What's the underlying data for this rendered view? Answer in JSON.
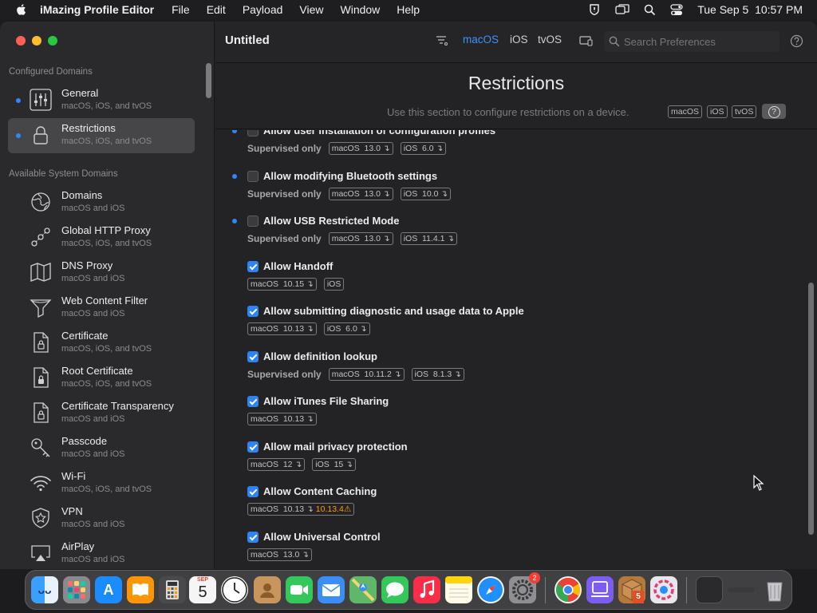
{
  "menubar": {
    "app_name": "iMazing Profile Editor",
    "menus": [
      "File",
      "Edit",
      "Payload",
      "View",
      "Window",
      "Help"
    ],
    "datetime": "Tue Sep 5  10:57 PM"
  },
  "toolbar": {
    "title": "Untitled",
    "platforms": [
      "macOS",
      "iOS",
      "tvOS"
    ],
    "active_platform": "macOS",
    "search_placeholder": "Search Preferences"
  },
  "sidebar": {
    "configured_title": "Configured Domains",
    "configured": [
      {
        "name": "General",
        "sub": "macOS, iOS, and tvOS",
        "icon": "sliders-icon"
      },
      {
        "name": "Restrictions",
        "sub": "macOS, iOS, and tvOS",
        "icon": "lock-icon"
      }
    ],
    "available_title": "Available System Domains",
    "available": [
      {
        "name": "Domains",
        "sub": "macOS and iOS",
        "icon": "globe-icon"
      },
      {
        "name": "Global HTTP Proxy",
        "sub": "macOS, iOS, and tvOS",
        "icon": "proxy-icon"
      },
      {
        "name": "DNS Proxy",
        "sub": "macOS and iOS",
        "icon": "map-icon"
      },
      {
        "name": "Web Content Filter",
        "sub": "macOS and iOS",
        "icon": "funnel-icon"
      },
      {
        "name": "Certificate",
        "sub": "macOS, iOS, and tvOS",
        "icon": "certificate-icon"
      },
      {
        "name": "Root Certificate",
        "sub": "macOS, iOS, and tvOS",
        "icon": "root-certificate-icon"
      },
      {
        "name": "Certificate Transparency",
        "sub": "macOS and iOS",
        "icon": "certificate-transparency-icon"
      },
      {
        "name": "Passcode",
        "sub": "macOS and iOS",
        "icon": "key-icon"
      },
      {
        "name": "Wi-Fi",
        "sub": "macOS, iOS, and tvOS",
        "icon": "wifi-icon"
      },
      {
        "name": "VPN",
        "sub": "macOS and iOS",
        "icon": "vpn-shield-icon"
      },
      {
        "name": "AirPlay",
        "sub": "macOS and iOS",
        "icon": "airplay-icon"
      }
    ]
  },
  "header": {
    "title": "Restrictions",
    "description": "Use this section to configure restrictions on a device.",
    "tags": [
      "macOS",
      "iOS",
      "tvOS"
    ],
    "help": "?"
  },
  "restrictions": [
    {
      "label": "Allow user installation of configuration profiles",
      "checked": false,
      "configured": true,
      "supervised": "Supervised only",
      "versions": [
        "macOS  13.0",
        "iOS  6.0"
      ]
    },
    {
      "label": "Allow modifying Bluetooth settings",
      "checked": false,
      "configured": true,
      "supervised": "Supervised only",
      "versions": [
        "macOS  13.0",
        "iOS  10.0"
      ]
    },
    {
      "label": "Allow USB Restricted Mode",
      "checked": false,
      "configured": true,
      "supervised": "Supervised only",
      "versions": [
        "macOS  13.0",
        "iOS  11.4.1"
      ]
    },
    {
      "label": "Allow Handoff",
      "checked": true,
      "configured": false,
      "supervised": "",
      "versions": [
        "macOS  10.15",
        "iOS"
      ]
    },
    {
      "label": "Allow submitting diagnostic and usage data to Apple",
      "checked": true,
      "configured": false,
      "supervised": "",
      "versions": [
        "macOS  10.13",
        "iOS  6.0"
      ]
    },
    {
      "label": "Allow definition lookup",
      "checked": true,
      "configured": false,
      "supervised": "Supervised only",
      "versions": [
        "macOS  10.11.2",
        "iOS  8.1.3"
      ]
    },
    {
      "label": "Allow iTunes File Sharing",
      "checked": true,
      "configured": false,
      "supervised": "",
      "versions": [
        "macOS  10.13"
      ]
    },
    {
      "label": "Allow mail privacy protection",
      "checked": true,
      "configured": false,
      "supervised": "",
      "versions": [
        "macOS  12",
        "iOS  15"
      ]
    },
    {
      "label": "Allow Content Caching",
      "checked": true,
      "configured": false,
      "supervised": "",
      "versions": [
        "macOS  10.13"
      ],
      "deprecated": "10.13.4"
    },
    {
      "label": "Allow Universal Control",
      "checked": true,
      "configured": false,
      "supervised": "",
      "versions": [
        "macOS  13.0"
      ]
    }
  ],
  "dock": {
    "apps": [
      {
        "name": "finder-icon",
        "color": "#2d8cf0"
      },
      {
        "name": "launchpad-icon",
        "color": "#8a8a8e"
      },
      {
        "name": "app-store-icon",
        "color": "#1a8cff"
      },
      {
        "name": "books-icon",
        "color": "#ff9500"
      },
      {
        "name": "calculator-icon",
        "color": "#4a4a4c"
      },
      {
        "name": "calendar-icon",
        "color": "#f5f5f5"
      },
      {
        "name": "clock-icon",
        "color": "#f5f5f5"
      },
      {
        "name": "contacts-icon",
        "color": "#c8955c"
      },
      {
        "name": "facetime-icon",
        "color": "#34c759"
      },
      {
        "name": "mail-icon",
        "color": "#3b8ef5"
      },
      {
        "name": "maps-icon",
        "color": "#5fb86a"
      },
      {
        "name": "messages-icon",
        "color": "#34c759"
      },
      {
        "name": "music-icon",
        "color": "#fa2d48"
      },
      {
        "name": "notes-icon",
        "color": "#ffd60a"
      },
      {
        "name": "safari-icon",
        "color": "#1e90ff"
      },
      {
        "name": "system-settings-icon",
        "color": "#8e8e93"
      },
      {
        "name": "chrome-icon",
        "color": "#f5f5f5"
      },
      {
        "name": "simulator-icon",
        "color": "#7d5cf0"
      },
      {
        "name": "package-icon",
        "color": "#b47a3c"
      },
      {
        "name": "imazing-profile-editor-icon",
        "color": "#e8e8ec"
      }
    ],
    "calendar": {
      "month": "SEP",
      "day": "5"
    },
    "settings_badge": "2",
    "html5_badge": "5"
  },
  "colors": {
    "accent": "#2f86ff",
    "deprecated": "#ff9f0a"
  }
}
